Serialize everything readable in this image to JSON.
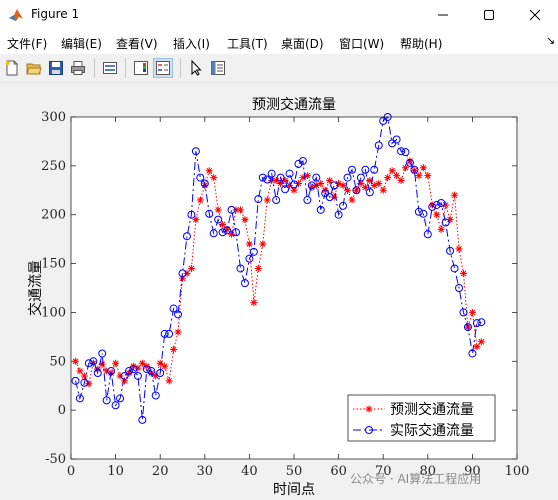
{
  "window": {
    "title": "Figure 1"
  },
  "menu": [
    "文件(F)",
    "编辑(E)",
    "查看(V)",
    "插入(I)",
    "工具(T)",
    "桌面(D)",
    "窗口(W)",
    "帮助(H)"
  ],
  "menu_overflow": "↘",
  "toolbar": [
    "new-figure-icon",
    "open-file-icon",
    "save-icon",
    "print-icon",
    "link-plot-icon",
    "colorbar-icon",
    "legend-icon",
    "pointer-icon",
    "property-inspector-icon"
  ],
  "watermark": "公众号 · AI算法工程应用",
  "chart_data": {
    "type": "line",
    "title": "预测交通流量",
    "xlabel": "时间点",
    "ylabel": "交通流量",
    "xlim": [
      0,
      100
    ],
    "ylim": [
      -50,
      300
    ],
    "xticks": [
      0,
      10,
      20,
      30,
      40,
      50,
      60,
      70,
      80,
      90,
      100
    ],
    "yticks": [
      -50,
      0,
      50,
      100,
      150,
      200,
      250,
      300
    ],
    "grid": false,
    "legend_position": "bottom-right",
    "series": [
      {
        "name": "预测交通流量",
        "color": "#ff0000",
        "style": "dotted-star",
        "x": [
          1,
          2,
          3,
          4,
          5,
          6,
          7,
          8,
          9,
          10,
          11,
          12,
          13,
          14,
          15,
          16,
          17,
          18,
          19,
          20,
          21,
          22,
          23,
          24,
          25,
          26,
          27,
          28,
          29,
          30,
          31,
          32,
          33,
          34,
          35,
          36,
          37,
          38,
          39,
          40,
          41,
          42,
          43,
          44,
          45,
          46,
          47,
          48,
          49,
          50,
          51,
          52,
          53,
          54,
          55,
          56,
          57,
          58,
          59,
          60,
          61,
          62,
          63,
          64,
          65,
          66,
          67,
          68,
          69,
          70,
          71,
          72,
          73,
          74,
          75,
          76,
          77,
          78,
          79,
          80,
          81,
          82,
          83,
          84,
          85,
          86,
          87,
          88,
          89,
          90,
          91,
          92
        ],
        "y": [
          50,
          40,
          35,
          27,
          48,
          42,
          47,
          40,
          38,
          48,
          35,
          30,
          38,
          45,
          43,
          48,
          45,
          38,
          35,
          48,
          45,
          30,
          62,
          80,
          135,
          140,
          145,
          195,
          215,
          230,
          245,
          238,
          205,
          190,
          185,
          180,
          205,
          205,
          195,
          170,
          110,
          145,
          170,
          215,
          235,
          235,
          232,
          235,
          230,
          225,
          232,
          238,
          240,
          228,
          230,
          232,
          225,
          235,
          218,
          232,
          230,
          225,
          215,
          225,
          232,
          228,
          235,
          230,
          232,
          225,
          238,
          245,
          240,
          235,
          248,
          255,
          245,
          240,
          248,
          240,
          210,
          200,
          185,
          210,
          195,
          220,
          165,
          140,
          85,
          100,
          65,
          70
        ]
      },
      {
        "name": "实际交通流量",
        "color": "#0000ff",
        "style": "dashdot-circle",
        "x": [
          1,
          2,
          3,
          4,
          5,
          6,
          7,
          8,
          9,
          10,
          11,
          12,
          13,
          14,
          15,
          16,
          17,
          18,
          19,
          20,
          21,
          22,
          23,
          24,
          25,
          26,
          27,
          28,
          29,
          30,
          31,
          32,
          33,
          34,
          35,
          36,
          37,
          38,
          39,
          40,
          41,
          42,
          43,
          44,
          45,
          46,
          47,
          48,
          49,
          50,
          51,
          52,
          53,
          54,
          55,
          56,
          57,
          58,
          59,
          60,
          61,
          62,
          63,
          64,
          65,
          66,
          67,
          68,
          69,
          70,
          71,
          72,
          73,
          74,
          75,
          76,
          77,
          78,
          79,
          80,
          81,
          82,
          83,
          84,
          85,
          86,
          87,
          88,
          89,
          90,
          91,
          92
        ],
        "y": [
          30,
          12,
          28,
          48,
          50,
          38,
          58,
          10,
          40,
          5,
          12,
          35,
          40,
          42,
          35,
          -10,
          42,
          40,
          15,
          38,
          78,
          78,
          104,
          98,
          140,
          178,
          200,
          265,
          238,
          232,
          201,
          181,
          195,
          182,
          184,
          205,
          182,
          145,
          130,
          155,
          162,
          216,
          238,
          236,
          242,
          215,
          238,
          226,
          242,
          231,
          252,
          255,
          215,
          230,
          238,
          205,
          222,
          218,
          230,
          200,
          209,
          238,
          246,
          225,
          238,
          246,
          223,
          246,
          271,
          296,
          300,
          273,
          277,
          265,
          264,
          253,
          246,
          203,
          201,
          180,
          208,
          210,
          212,
          192,
          163,
          145,
          125,
          100,
          85,
          58,
          89,
          90
        ]
      }
    ]
  }
}
